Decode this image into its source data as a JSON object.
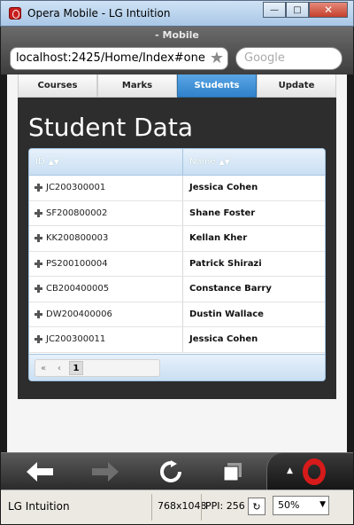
{
  "window": {
    "title": "Opera Mobile - LG Intuition",
    "minimize_icon": "minimize-icon",
    "maximize_icon": "maximize-icon",
    "close_icon": "close-icon"
  },
  "browser": {
    "page_title": "- Mobile",
    "url": "localhost:2425/Home/Index#one",
    "search_placeholder": "Google"
  },
  "nav": {
    "tabs": [
      {
        "label": "Courses"
      },
      {
        "label": "Marks"
      },
      {
        "label": "Students",
        "active": true
      },
      {
        "label": "Update"
      }
    ]
  },
  "main": {
    "title": "Student Data",
    "grid": {
      "columns": [
        "ID",
        "Name"
      ],
      "rows": [
        {
          "id": "JC200300001",
          "name": "Jessica Cohen"
        },
        {
          "id": "SF200800002",
          "name": "Shane Foster"
        },
        {
          "id": "KK200800003",
          "name": "Kellan Kher"
        },
        {
          "id": "PS200100004",
          "name": "Patrick Shirazi"
        },
        {
          "id": "CB200400005",
          "name": "Constance Barry"
        },
        {
          "id": "DW200400006",
          "name": "Dustin Wallace"
        },
        {
          "id": "JC200300011",
          "name": "Jessica Cohen"
        }
      ],
      "pager": {
        "first": "«",
        "prev": "‹",
        "page": "1"
      }
    }
  },
  "statusbar": {
    "device": "LG Intuition",
    "resolution": "768x1048",
    "ppi": "PPI: 256",
    "zoom": "50%"
  },
  "colors": {
    "active_tab": "#2f81c9",
    "content_bg": "#2d2d2d",
    "opera_red": "#d71a1a"
  }
}
